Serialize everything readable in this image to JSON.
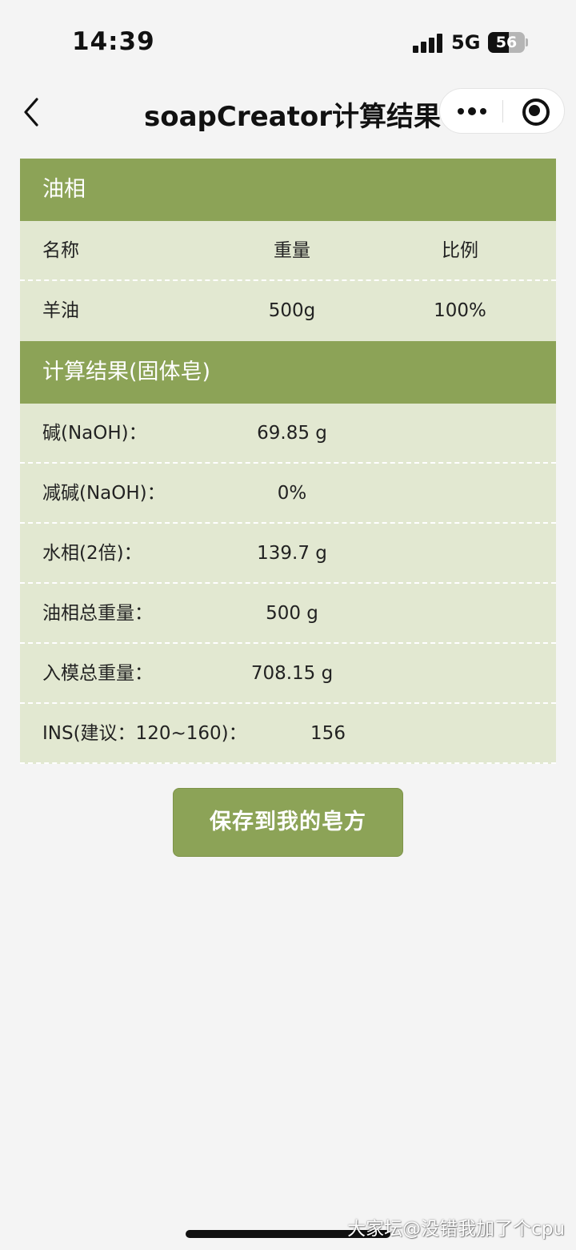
{
  "status_bar": {
    "time": "14:39",
    "network": "5G",
    "battery_level": "56",
    "battery_fraction": 0.56
  },
  "nav": {
    "title": "soapCreator计算结果",
    "back_icon": "chevron-left-icon",
    "more_icon": "more-dots-icon",
    "close_icon": "target-circle-icon"
  },
  "oil_section": {
    "header": "油相",
    "columns": [
      "名称",
      "重量",
      "比例"
    ],
    "rows": [
      {
        "name": "羊油",
        "weight": "500g",
        "ratio": "100%"
      }
    ]
  },
  "result_section": {
    "header": "计算结果(固体皂)",
    "rows": [
      {
        "label": "碱(NaOH)：",
        "value": "69.85 g"
      },
      {
        "label": "减碱(NaOH)：",
        "value": "0%"
      },
      {
        "label": "水相(2倍)：",
        "value": "139.7 g"
      },
      {
        "label": "油相总重量：",
        "value": "500 g"
      },
      {
        "label": "入模总重量：",
        "value": "708.15 g"
      },
      {
        "label": "INS(建议：120~160)：",
        "value": "156"
      }
    ]
  },
  "save_button": "保存到我的皂方",
  "watermark": "大家坛@没错我加了个cpu",
  "colors": {
    "accent": "#8ca357",
    "row_background": "#e2e8d1",
    "page_background": "#f4f4f4"
  }
}
